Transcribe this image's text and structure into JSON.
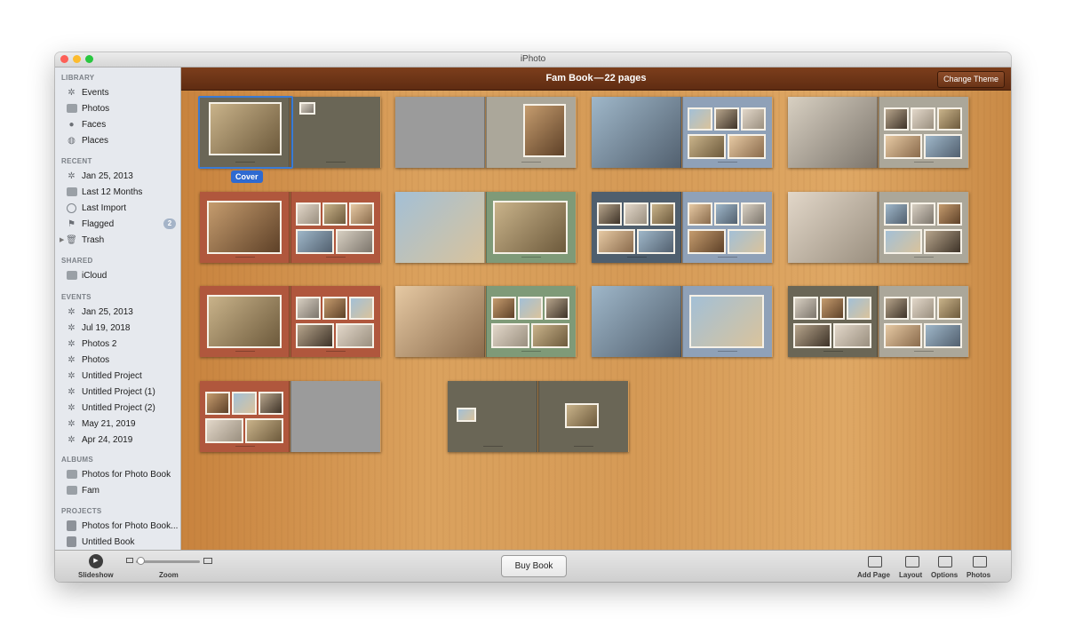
{
  "window": {
    "title": "iPhoto"
  },
  "sidebar": {
    "library": {
      "header": "LIBRARY",
      "items": [
        {
          "label": "Events",
          "icon": "palm-icon"
        },
        {
          "label": "Photos",
          "icon": "photos-icon"
        },
        {
          "label": "Faces",
          "icon": "faces-icon"
        },
        {
          "label": "Places",
          "icon": "globe-icon"
        }
      ]
    },
    "recent": {
      "header": "RECENT",
      "items": [
        {
          "label": "Jan 25, 2013",
          "icon": "palm-icon"
        },
        {
          "label": "Last 12 Months",
          "icon": "calendar-icon"
        },
        {
          "label": "Last Import",
          "icon": "clock-icon"
        },
        {
          "label": "Flagged",
          "icon": "flag-icon",
          "badge": "2"
        },
        {
          "label": "Trash",
          "icon": "trash-icon"
        }
      ]
    },
    "shared": {
      "header": "SHARED",
      "items": [
        {
          "label": "iCloud",
          "icon": "cloud-icon"
        }
      ]
    },
    "events": {
      "header": "EVENTS",
      "items": [
        {
          "label": "Jan 25, 2013"
        },
        {
          "label": "Jul 19, 2018"
        },
        {
          "label": "Photos 2"
        },
        {
          "label": "Photos"
        },
        {
          "label": "Untitled Project"
        },
        {
          "label": "Untitled Project (1)"
        },
        {
          "label": "Untitled Project (2)"
        },
        {
          "label": "May 21, 2019"
        },
        {
          "label": "Apr 24, 2019"
        }
      ]
    },
    "albums": {
      "header": "ALBUMS",
      "items": [
        {
          "label": "Photos for Photo Book"
        },
        {
          "label": "Fam"
        }
      ]
    },
    "projects": {
      "header": "PROJECTS",
      "items": [
        {
          "label": "Photos for Photo Book..."
        },
        {
          "label": "Untitled Book"
        }
      ]
    }
  },
  "main": {
    "book_title": "Fam Book — 22 pages",
    "change_theme": "Change Theme",
    "cover_label": "Cover"
  },
  "toolbar": {
    "slideshow": "Slideshow",
    "zoom": "Zoom",
    "buy_book": "Buy Book",
    "add_page": "Add Page",
    "layout": "Layout",
    "options": "Options",
    "photos": "Photos"
  },
  "colors": {
    "banner": "#6d3417",
    "wood": "#d59a56",
    "selection": "#2f6ad0",
    "page_slate": "#6a6656",
    "page_rust": "#b0573d",
    "page_sage": "#7f9a78",
    "page_blue": "#8fa1b8",
    "page_navy": "#4f5f6e",
    "page_gray": "#9b9b9b",
    "page_tan": "#aba79a",
    "page_white": "#f1efea"
  }
}
